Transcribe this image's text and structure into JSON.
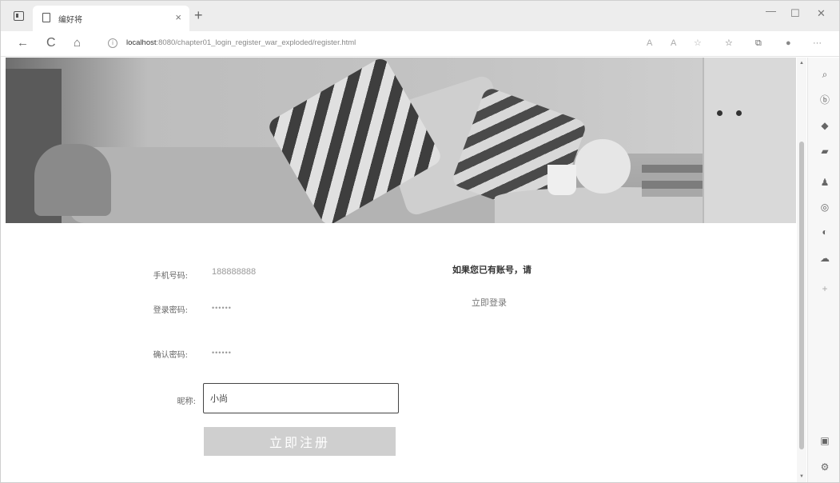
{
  "browser": {
    "tab_title": "编好将",
    "tab_close": "×",
    "new_tab": "+",
    "url_host": "localhost",
    "url_path": ":8080/chapter01_login_register_war_exploded/register.html",
    "window_controls": {
      "minimize": "—",
      "maximize": "☐",
      "close": "✕"
    },
    "nav": {
      "back": "←",
      "reload": "C",
      "home": "⌂",
      "info": "i"
    },
    "toolbar_icons": [
      "read-aloud-icon",
      "translate-icon",
      "tracking-icon",
      "favorites-star-icon",
      "collections-icon",
      "profile-icon",
      "more-icon"
    ],
    "toolbar_glyphs": [
      "A",
      "A",
      "☆",
      "☆",
      "⧉",
      "●",
      "···"
    ]
  },
  "sidebar": {
    "icons": [
      "search-icon",
      "bing-icon",
      "tag-icon",
      "briefcase-icon",
      "games-icon",
      "circle-app-icon",
      "office-icon",
      "outlook-icon",
      "add-icon",
      "screen-icon",
      "settings-icon"
    ],
    "glyphs": [
      "⌕",
      "ⓑ",
      "◆",
      "▰",
      "♟",
      "◎",
      "◐",
      "☁",
      "+",
      "▣",
      "⚙"
    ]
  },
  "form": {
    "phone_label": "手机号码:",
    "phone_value": "188888888",
    "password_label": "登录密码:",
    "password_value": "••••••",
    "confirm_label": "确认密码:",
    "confirm_value": "••••••",
    "nickname_label": "昵称:",
    "nickname_value": "小尚",
    "register_button": "立即注册"
  },
  "login": {
    "prompt": "如果您已有账号，请",
    "link": "立即登录"
  }
}
